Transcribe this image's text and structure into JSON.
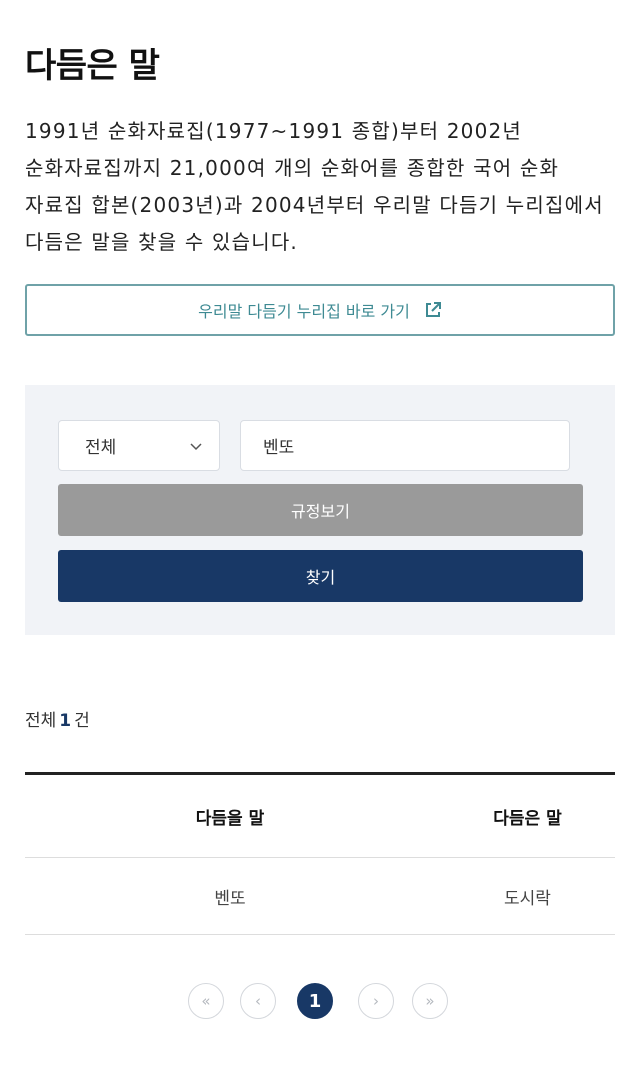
{
  "page": {
    "title": "다듬은 말",
    "description": "1991년 순화자료집(1977~1991 종합)부터 2002년 순화자료집까지 21,000여 개의 순화어를 종합한 국어 순화 자료집 합본(2003년)과 2004년부터 우리말 다듬기 누리집에서 다듬은 말을 찾을 수 있습니다."
  },
  "link_button": {
    "label": "우리말 다듬기 누리집 바로 가기",
    "icon": "external-link-icon"
  },
  "search": {
    "category_selected": "전체",
    "query_value": "벤또",
    "rule_button_label": "규정보기",
    "find_button_label": "찾기"
  },
  "results": {
    "count_prefix": "전체",
    "count": "1",
    "count_suffix": "건",
    "headers": [
      "다듬을 말",
      "다듬은 말"
    ],
    "rows": [
      {
        "original": "벤또",
        "refined": "도시락"
      }
    ]
  },
  "pagination": {
    "first": "«",
    "prev": "‹",
    "current": "1",
    "next": "›",
    "last": "»"
  },
  "colors": {
    "accent_navy": "#183866",
    "link_teal": "#3e8a93",
    "panel_bg": "#f1f3f7",
    "rule_button_gray": "#9a9a9a"
  }
}
